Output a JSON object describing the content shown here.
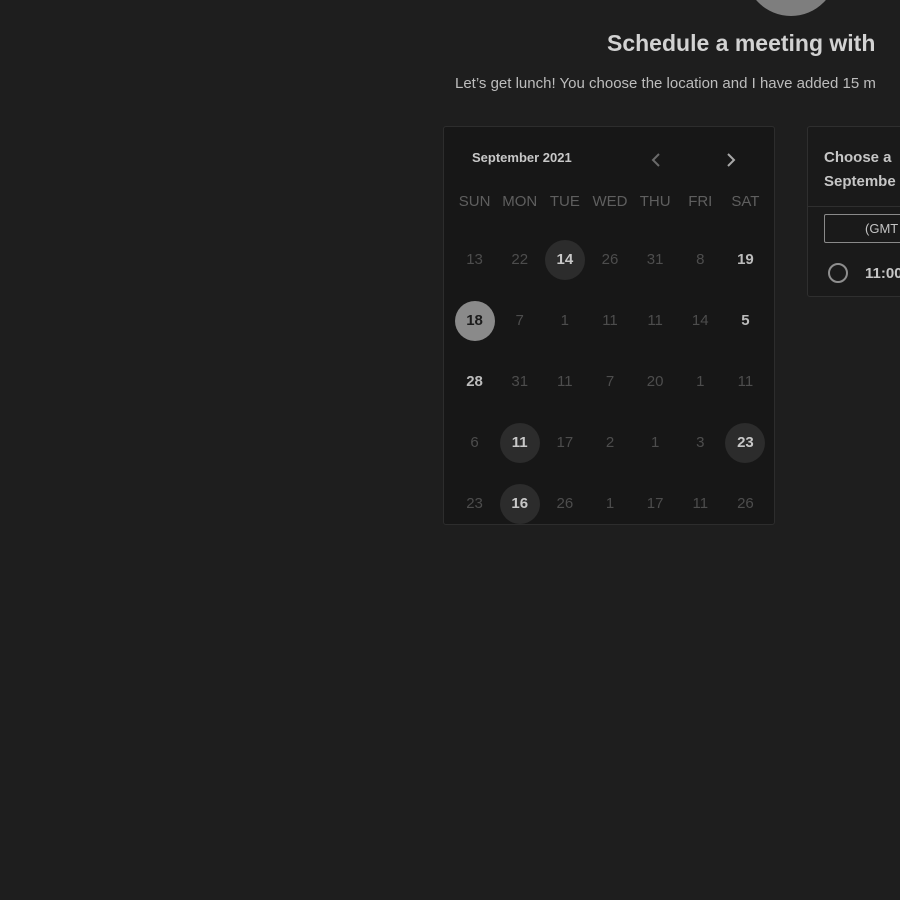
{
  "header": {
    "title": "Schedule a meeting with",
    "subtitle": "Let’s get lunch! You choose the location and I have added 15 m"
  },
  "calendar": {
    "month": "September 2021",
    "weekdays": [
      "SUN",
      "MON",
      "TUE",
      "WED",
      "THU",
      "FRI",
      "SAT"
    ],
    "weeks": [
      [
        {
          "label": "13",
          "state": "muted"
        },
        {
          "label": "22",
          "state": "muted"
        },
        {
          "label": "14",
          "state": "available"
        },
        {
          "label": "26",
          "state": "muted"
        },
        {
          "label": "31",
          "state": "muted"
        },
        {
          "label": "8",
          "state": "muted"
        },
        {
          "label": "19",
          "state": "active"
        }
      ],
      [
        {
          "label": "18",
          "state": "selected"
        },
        {
          "label": "7",
          "state": "muted"
        },
        {
          "label": "1",
          "state": "muted"
        },
        {
          "label": "11",
          "state": "muted"
        },
        {
          "label": "11",
          "state": "muted"
        },
        {
          "label": "14",
          "state": "muted"
        },
        {
          "label": "5",
          "state": "active"
        }
      ],
      [
        {
          "label": "28",
          "state": "active"
        },
        {
          "label": "31",
          "state": "muted"
        },
        {
          "label": "11",
          "state": "muted"
        },
        {
          "label": "7",
          "state": "muted"
        },
        {
          "label": "20",
          "state": "muted"
        },
        {
          "label": "1",
          "state": "muted"
        },
        {
          "label": "11",
          "state": "muted"
        }
      ],
      [
        {
          "label": "6",
          "state": "muted"
        },
        {
          "label": "11",
          "state": "available"
        },
        {
          "label": "17",
          "state": "muted"
        },
        {
          "label": "2",
          "state": "muted"
        },
        {
          "label": "1",
          "state": "muted"
        },
        {
          "label": "3",
          "state": "muted"
        },
        {
          "label": "23",
          "state": "available"
        }
      ],
      [
        {
          "label": "23",
          "state": "muted"
        },
        {
          "label": "16",
          "state": "available"
        },
        {
          "label": "26",
          "state": "muted"
        },
        {
          "label": "1",
          "state": "muted"
        },
        {
          "label": "17",
          "state": "muted"
        },
        {
          "label": "11",
          "state": "muted"
        },
        {
          "label": "26",
          "state": "muted"
        }
      ]
    ],
    "nav": {
      "prev_icon": "chevron-left-icon",
      "next_icon": "chevron-right-icon"
    }
  },
  "times": {
    "heading_line1": "Choose a",
    "heading_line2": "Septembe",
    "timezone": "(GMT",
    "slots": [
      {
        "label": "11:00"
      }
    ]
  },
  "colors": {
    "background": "#1e1e1e",
    "panel": "#171717",
    "selected_day": "#8a8a8a",
    "available_day": "#2c2c2c"
  }
}
